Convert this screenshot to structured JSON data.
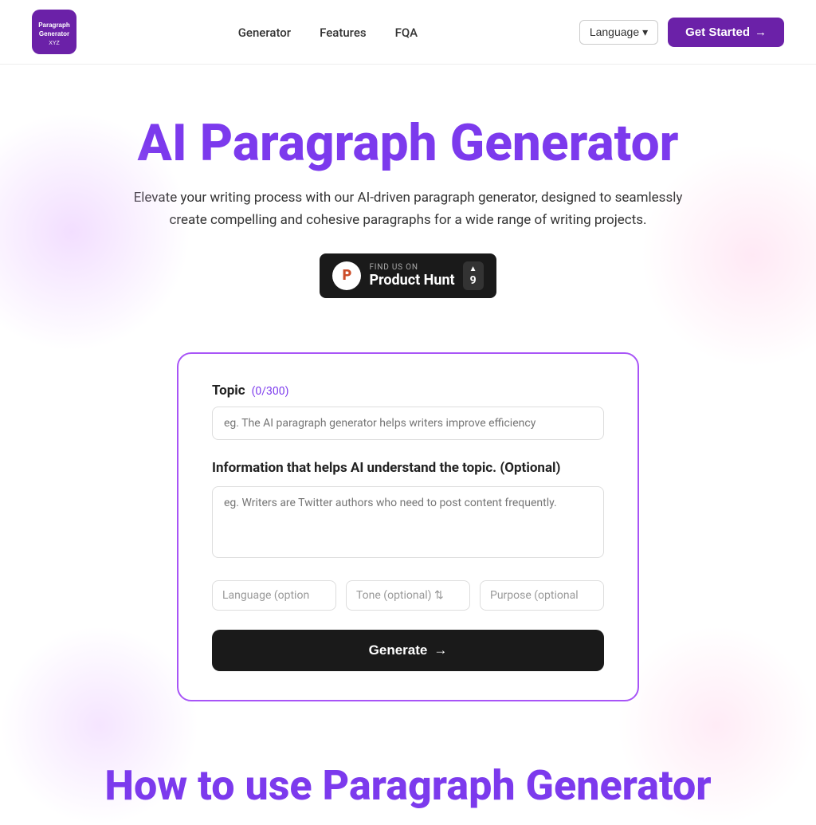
{
  "nav": {
    "logo_text": "Paragraph\nGenerator\nXYZ",
    "links": [
      {
        "label": "Generator",
        "id": "generator"
      },
      {
        "label": "Features",
        "id": "features"
      },
      {
        "label": "FQA",
        "id": "fqa"
      }
    ],
    "language_btn": "Language",
    "get_started_btn": "Get Started",
    "arrow": "→"
  },
  "hero": {
    "title": "AI Paragraph Generator",
    "subtitle": "Elevate your writing process with our AI-driven paragraph generator, designed to seamlessly create compelling and cohesive paragraphs for a wide range of writing projects.",
    "product_hunt": {
      "find_us": "FIND US ON",
      "name": "Product Hunt",
      "votes": "9",
      "arrow": "▲"
    }
  },
  "form": {
    "topic_label": "Topic",
    "topic_counter": "(0/300)",
    "topic_placeholder": "eg. The AI paragraph generator helps writers improve efficiency",
    "info_label": "Information that helps AI understand the topic. (Optional)",
    "info_placeholder": "eg. Writers are Twitter authors who need to post content frequently.",
    "language_placeholder": "Language (option",
    "tone_placeholder": "Tone (optional)",
    "tone_arrow": "⇅",
    "purpose_placeholder": "Purpose (optional",
    "generate_btn": "Generate",
    "generate_arrow": "→"
  },
  "bottom": {
    "heading": "How to use Paragraph Generator"
  },
  "icons": {
    "chevron_down": "▾",
    "arrow_right": "→",
    "triangle_up": "▲"
  }
}
